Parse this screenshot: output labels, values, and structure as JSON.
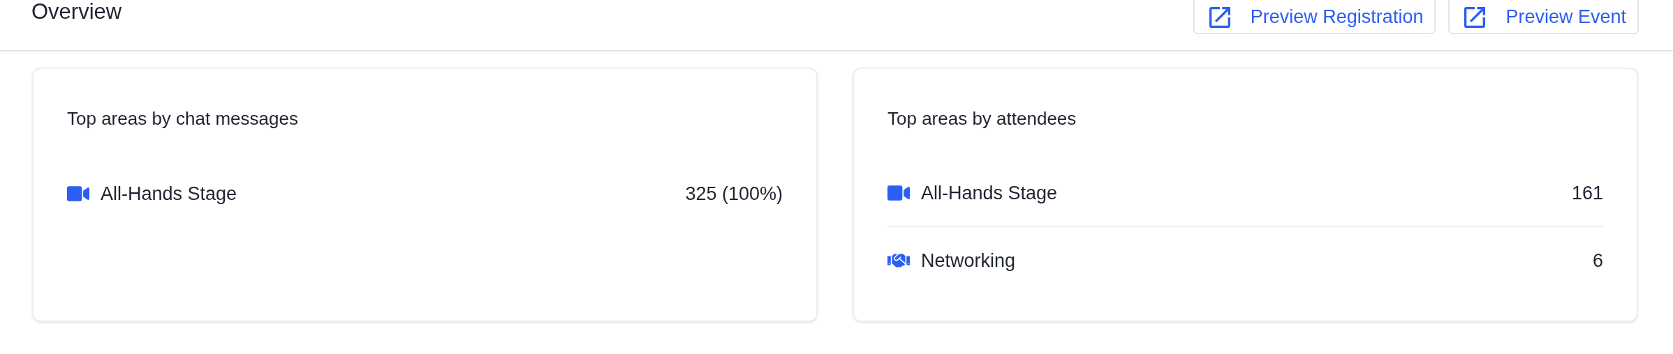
{
  "header": {
    "title": "Overview",
    "buttons": [
      {
        "label": "Preview Registration"
      },
      {
        "label": "Preview Event"
      }
    ]
  },
  "cards": [
    {
      "title": "Top areas by chat messages",
      "rows": [
        {
          "kind": "stage",
          "name": "All-Hands Stage",
          "value": "325 (100%)"
        }
      ]
    },
    {
      "title": "Top areas by attendees",
      "rows": [
        {
          "kind": "stage",
          "name": "All-Hands Stage",
          "value": "161"
        },
        {
          "kind": "networking",
          "name": "Networking",
          "value": "6"
        }
      ]
    }
  ]
}
